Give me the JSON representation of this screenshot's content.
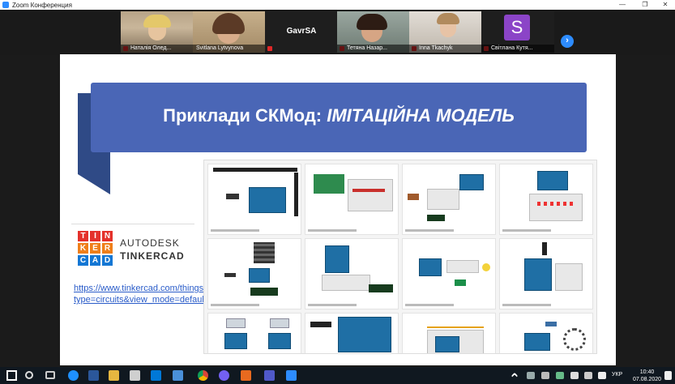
{
  "window": {
    "title": "Zoom Конференция"
  },
  "participants": [
    {
      "name": "Наталія Олед...",
      "muted": true
    },
    {
      "name": "Svitlana Lytvynova",
      "muted": false
    },
    {
      "name": "GavrSA",
      "muted": true
    },
    {
      "name": "Тетяна Назар...",
      "muted": true
    },
    {
      "name": "Inna Tkachyk",
      "muted": true
    },
    {
      "name": "Світлана Кутя...",
      "muted": true,
      "avatar_letter": "S"
    }
  ],
  "slide": {
    "title_plain": "Приклади СКМод: ",
    "title_em": "ІМІТАЦІЙНА МОДЕЛЬ",
    "logo": {
      "letters": [
        "T",
        "I",
        "N",
        "K",
        "E",
        "R",
        "C",
        "A",
        "D"
      ],
      "line1": "AUTODESK",
      "line2": "TINKERCAD"
    },
    "link": "https://www.tinkercad.com/things?type=circuits&view_mode=default"
  },
  "taskbar": {
    "lang": "УКР",
    "time": "10:40",
    "date": "07.08.2020"
  },
  "colors": {
    "banner": "#4a66b6",
    "zoom_blue": "#2d8cff",
    "avatar": "#8b44c7"
  }
}
